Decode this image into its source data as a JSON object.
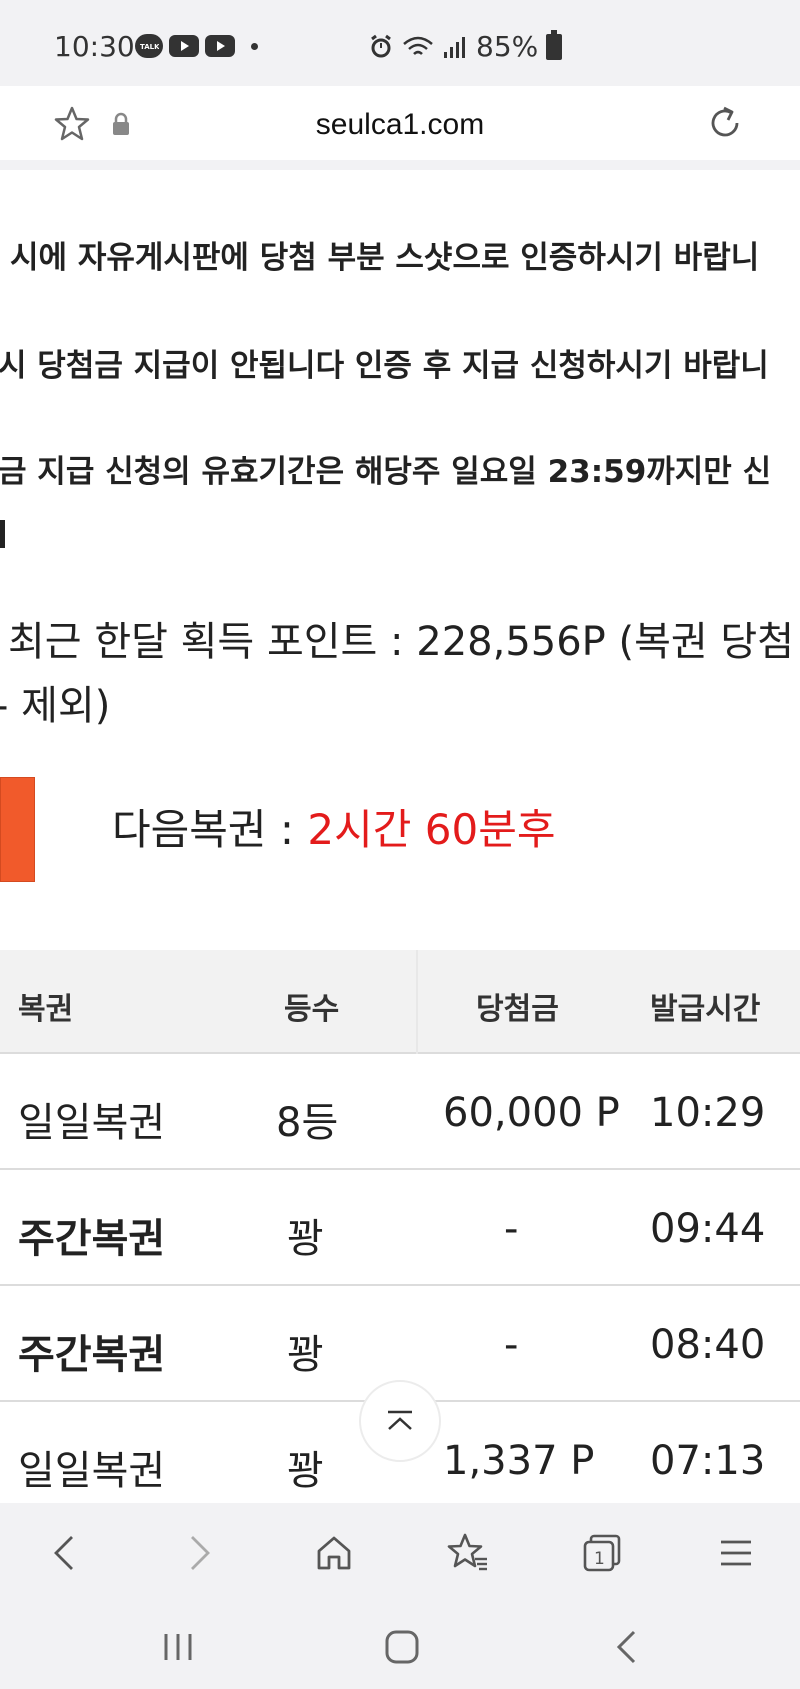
{
  "status_bar": {
    "time": "10:30",
    "notifications": [
      "talk-icon",
      "youtube-icon",
      "youtube-icon"
    ],
    "battery": "85%"
  },
  "url_bar": {
    "url": "seulca1.com"
  },
  "notices": [
    "시에 자유게시판에 당첨 부분 스샷으로 인증하시기 바랍니",
    "시 당첨금 지급이 안됩니다 인증 후 지급 신청하시기 바랍니",
    "금 지급 신청의 유효기간은 해당주 일요일 23:59까지만 신"
  ],
  "points": {
    "line1": "최근 한달 획득 포인트 : 228,556P (복권 당첨",
    "line2": "- 제외)"
  },
  "next_lotto": {
    "label": "다음복권 : ",
    "value": "2시간 60분후",
    "value_color": "#e31b1b"
  },
  "table": {
    "headers": [
      "복권",
      "등수",
      "당첨금",
      "발급시간"
    ],
    "rows": [
      {
        "lotto": "일일복권",
        "rank": "8등",
        "prize": "60,000 P",
        "time": "10:29",
        "bold": false
      },
      {
        "lotto": "주간복권",
        "rank": "꽝",
        "prize": "-",
        "time": "09:44",
        "bold": true
      },
      {
        "lotto": "주간복권",
        "rank": "꽝",
        "prize": "-",
        "time": "08:40",
        "bold": true
      },
      {
        "lotto": "일일복권",
        "rank": "꽝",
        "prize": "1,337 P",
        "time": "07:13",
        "bold": false
      }
    ]
  },
  "toolbar": [
    "back-icon",
    "forward-icon",
    "home-icon",
    "bookmarks-icon",
    "tabs-icon",
    "menu-icon"
  ],
  "toolbar_tabs_count": "1",
  "colors": {
    "accent_orange": "#f15a2b",
    "countdown_red": "#e31b1b"
  }
}
